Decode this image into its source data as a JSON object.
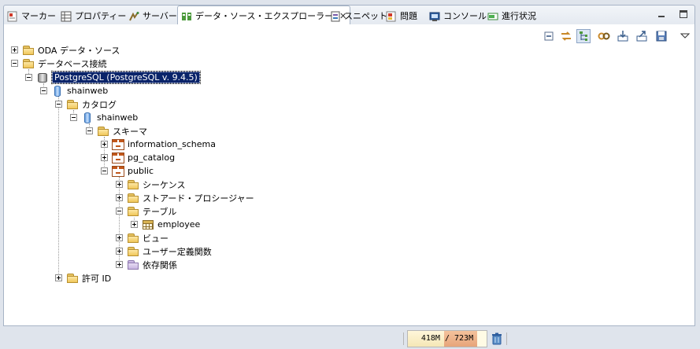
{
  "tabs": [
    {
      "label": "マーカー",
      "icon": "markers-icon"
    },
    {
      "label": "プロパティー",
      "icon": "properties-icon"
    },
    {
      "label": "サーバー",
      "icon": "servers-icon"
    },
    {
      "label": "データ・ソース・エクスプローラー",
      "icon": "data-source-explorer-icon",
      "active": true
    },
    {
      "label": "スニペット",
      "icon": "snippets-icon"
    },
    {
      "label": "問題",
      "icon": "problems-icon"
    },
    {
      "label": "コンソール",
      "icon": "console-icon"
    },
    {
      "label": "進行状況",
      "icon": "progress-icon"
    }
  ],
  "active_tab_close": "✕",
  "tree": [
    {
      "id": "oda",
      "label": "ODA データ・ソース",
      "icon": "folder-icon",
      "expanded": false
    },
    {
      "id": "db-connections",
      "label": "データベース接続",
      "icon": "folder-icon",
      "expanded": true
    },
    {
      "id": "postgres",
      "label": "PostgreSQL (PostgreSQL v. 9.4.5)",
      "icon": "database-connection-icon",
      "expanded": true,
      "selected": true
    },
    {
      "id": "db-shainweb",
      "label": "shainweb",
      "icon": "database-icon",
      "expanded": true
    },
    {
      "id": "catalog",
      "label": "カタログ",
      "icon": "folder-icon",
      "expanded": true
    },
    {
      "id": "catalog-shainweb",
      "label": "shainweb",
      "icon": "database-icon",
      "expanded": true
    },
    {
      "id": "schemas",
      "label": "スキーマ",
      "icon": "folder-icon",
      "expanded": true
    },
    {
      "id": "information-schema",
      "label": "information_schema",
      "icon": "schema-icon",
      "expanded": false
    },
    {
      "id": "pg-catalog",
      "label": "pg_catalog",
      "icon": "schema-icon",
      "expanded": false
    },
    {
      "id": "public",
      "label": "public",
      "icon": "schema-icon",
      "expanded": true
    },
    {
      "id": "sequences",
      "label": "シーケンス",
      "icon": "folder-icon",
      "expanded": false
    },
    {
      "id": "stored-procedures",
      "label": "ストアード・プロシージャー",
      "icon": "folder-icon",
      "expanded": false
    },
    {
      "id": "tables",
      "label": "テーブル",
      "icon": "folder-icon",
      "expanded": true
    },
    {
      "id": "employee",
      "label": "employee",
      "icon": "table-icon",
      "expanded": false
    },
    {
      "id": "views",
      "label": "ビュー",
      "icon": "folder-icon",
      "expanded": false
    },
    {
      "id": "udf",
      "label": "ユーザー定義関数",
      "icon": "folder-icon",
      "expanded": false
    },
    {
      "id": "dependencies",
      "label": "依存関係",
      "icon": "purple-folder-icon",
      "expanded": false
    },
    {
      "id": "auth-ids",
      "label": "許可 ID",
      "icon": "folder-icon",
      "expanded": false
    }
  ],
  "toolbar_icons": [
    "collapse-all-icon",
    "link-with-editor-icon",
    "hierarchy-icon",
    "connect-icon",
    "import-icon",
    "export-icon",
    "save-icon",
    "view-menu-icon"
  ],
  "heap": {
    "used": "418M",
    "total": "723M",
    "text": "418M / 723M",
    "used_fraction": 0.578
  },
  "colors": {
    "selection": "#0a246a",
    "tab_border": "#a7b4c6",
    "background": "#dfe4ec"
  }
}
